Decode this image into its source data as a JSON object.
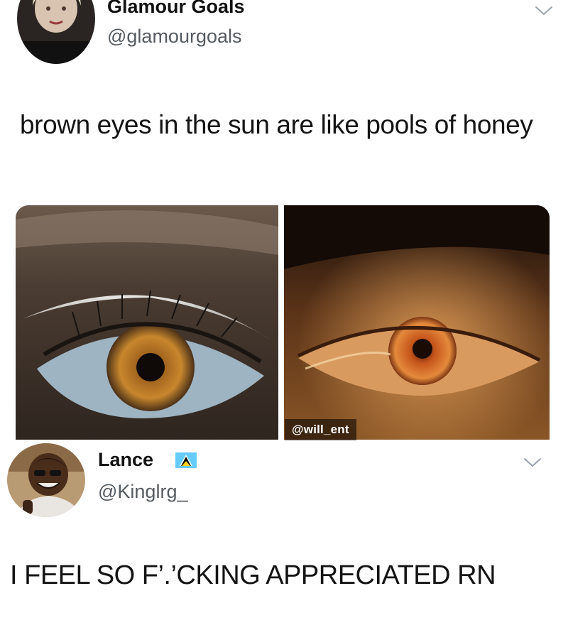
{
  "tweet1": {
    "display_name": "Glamour Goals",
    "handle": "@glamourgoals",
    "text": "brown eyes in the sun are like pools of honey",
    "avatar_icon": "profile-photo",
    "menu_icon": "chevron-down-icon"
  },
  "media": {
    "watermark": "@will_ent",
    "left_photo": "eye-closeup-photo",
    "right_photo": "eye-sunlit-photo"
  },
  "tweet2": {
    "display_name": "Lance",
    "flag_icon": "saint-lucia-flag-icon",
    "handle": "@Kinglrg_",
    "text": "I FEEL SO F’.’CKING APPRECIATED RN",
    "avatar_icon": "profile-photo",
    "menu_icon": "chevron-down-icon"
  },
  "colors": {
    "background": "#ffffff",
    "text": "#141414",
    "handle": "#555b60",
    "chevron": "#9aa3ab",
    "flag_blue": "#66ccff",
    "flag_yellow": "#fcd116"
  }
}
